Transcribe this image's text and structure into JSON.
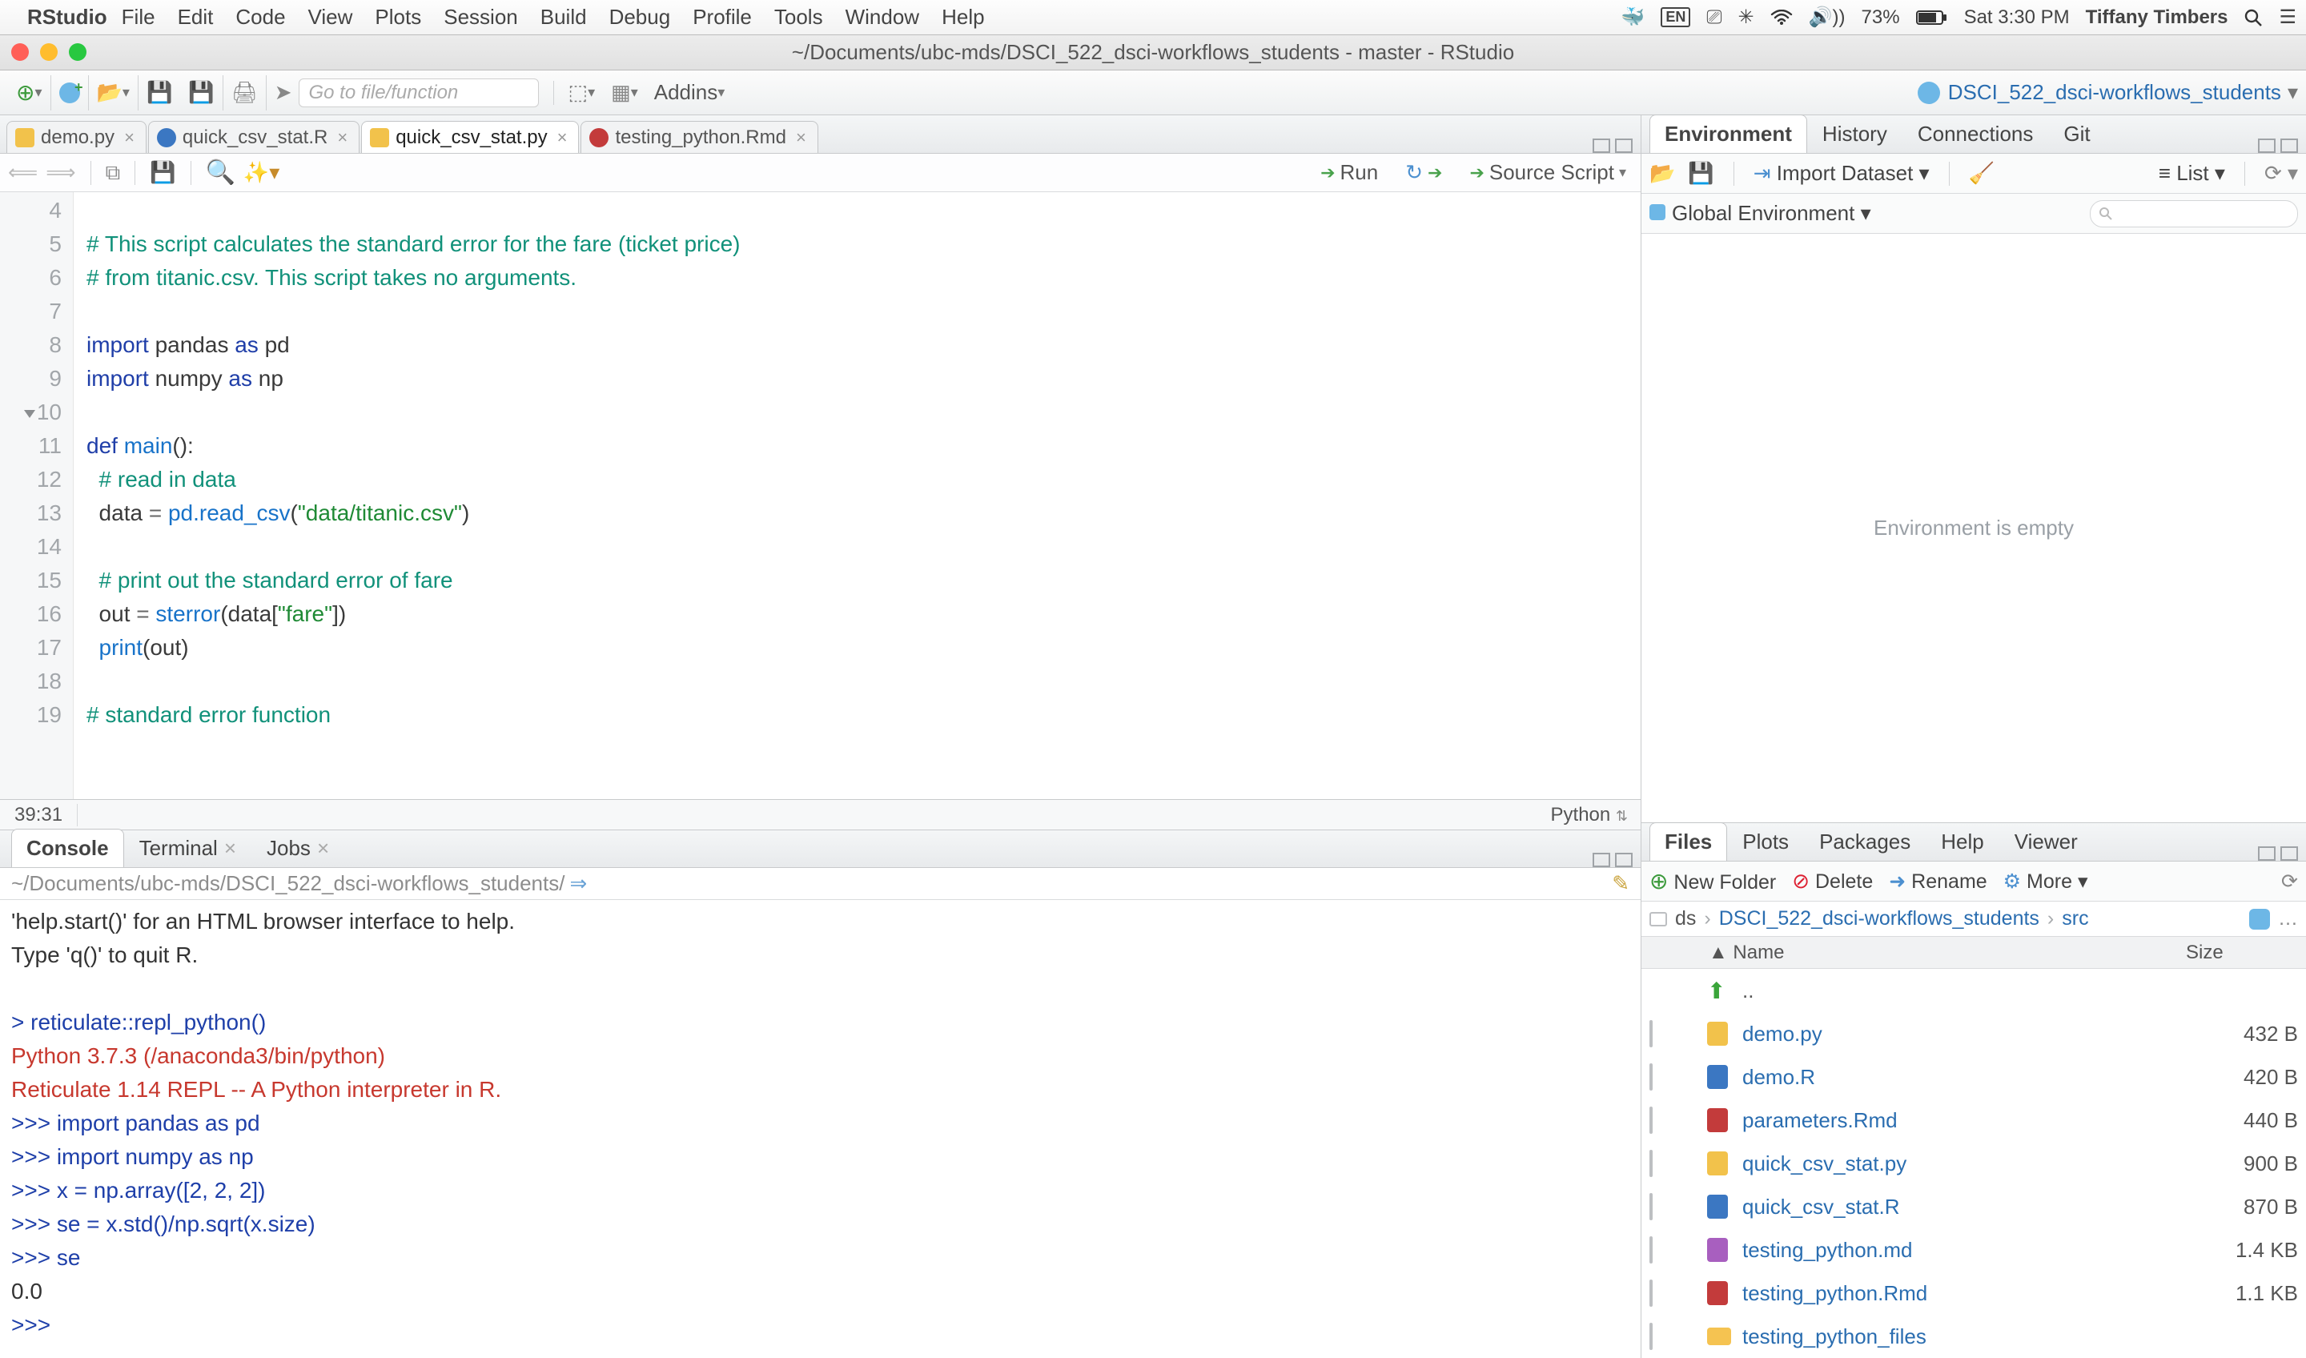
{
  "menubar": {
    "app": "RStudio",
    "items": [
      "File",
      "Edit",
      "Code",
      "View",
      "Plots",
      "Session",
      "Build",
      "Debug",
      "Profile",
      "Tools",
      "Window",
      "Help"
    ],
    "battery": "73%",
    "clock": "Sat 3:30 PM",
    "user": "Tiffany Timbers"
  },
  "window": {
    "title": "~/Documents/ubc-mds/DSCI_522_dsci-workflows_students - master - RStudio"
  },
  "maintoolbar": {
    "goto_placeholder": "Go to file/function",
    "addins": "Addins",
    "project": "DSCI_522_dsci-workflows_students"
  },
  "source": {
    "tabs": [
      {
        "label": "demo.py",
        "icon": "#f2c24b"
      },
      {
        "label": "quick_csv_stat.R",
        "icon": "#3b77c2"
      },
      {
        "label": "quick_csv_stat.py",
        "icon": "#f2c24b",
        "active": true
      },
      {
        "label": "testing_python.Rmd",
        "icon": "#c33b3b"
      }
    ],
    "run": "Run",
    "source_script": "Source Script",
    "gutter": [
      "4",
      "5",
      "6",
      "7",
      "8",
      "9",
      "10",
      "11",
      "12",
      "13",
      "14",
      "15",
      "16",
      "17",
      "18",
      "19"
    ],
    "status_pos": "39:31",
    "status_lang": "Python"
  },
  "codelines": {
    "l4": "# This script calculates the standard error for the fare (ticket price)",
    "l5": "# from titanic.csv. This script takes no arguments.",
    "l7a": "import",
    "l7b": " pandas ",
    "l7c": "as",
    "l7d": " pd",
    "l8a": "import",
    "l8b": " numpy ",
    "l8c": "as",
    "l8d": " np",
    "l10a": "def",
    "l10b": " main",
    "l10c": "():",
    "l11": "  # read in data",
    "l12a": "  data ",
    "l12b": "=",
    "l12c": " pd.read_csv",
    "l12d": "(",
    "l12e": "\"data/titanic.csv\"",
    "l12f": ")",
    "l14": "  # print out the standard error of fare",
    "l15a": "  out ",
    "l15b": "=",
    "l15c": " sterror",
    "l15d": "(",
    "l15e": "data",
    "l15f": "[",
    "l15g": "\"fare\"",
    "l15h": "])",
    "l16a": "  print",
    "l16b": "(",
    "l16c": "out",
    "l16d": ")",
    "l18": "# standard error function"
  },
  "consolepane": {
    "tabs": [
      "Console",
      "Terminal",
      "Jobs"
    ],
    "path": "~/Documents/ubc-mds/DSCI_522_dsci-workflows_students/",
    "lines": [
      {
        "t": "'help.start()' for an HTML browser interface to help.",
        "cls": ""
      },
      {
        "t": "Type 'q()' to quit R.",
        "cls": ""
      },
      {
        "t": "",
        "cls": ""
      },
      {
        "t": "> reticulate::repl_python()",
        "cls": "pr"
      },
      {
        "t": "Python 3.7.3 (/anaconda3/bin/python)",
        "cls": "red"
      },
      {
        "t": "Reticulate 1.14 REPL -- A Python interpreter in R.",
        "cls": "red"
      },
      {
        "t": ">>> import pandas as pd",
        "cls": "pr"
      },
      {
        "t": ">>> import numpy as np",
        "cls": "pr"
      },
      {
        "t": ">>> x = np.array([2, 2, 2])",
        "cls": "pr"
      },
      {
        "t": ">>> se = x.std()/np.sqrt(x.size)",
        "cls": "pr"
      },
      {
        "t": ">>> se",
        "cls": "pr"
      },
      {
        "t": "0.0",
        "cls": ""
      },
      {
        "t": ">>>",
        "cls": "pr"
      }
    ]
  },
  "env": {
    "tabs": [
      "Environment",
      "History",
      "Connections",
      "Git"
    ],
    "import": "Import Dataset",
    "list": "List",
    "scope": "Global Environment",
    "empty": "Environment is empty"
  },
  "filespane": {
    "tabs": [
      "Files",
      "Plots",
      "Packages",
      "Help",
      "Viewer"
    ],
    "newfolder": "New Folder",
    "delete": "Delete",
    "rename": "Rename",
    "more": "More",
    "crumbs": [
      "ds",
      "DSCI_522_dsci-workflows_students",
      "src"
    ],
    "hdr_name": "Name",
    "hdr_size": "Size",
    "up_label": "..",
    "files": [
      {
        "name": "demo.py",
        "size": "432 B",
        "color": "#f2c24b"
      },
      {
        "name": "demo.R",
        "size": "420 B",
        "color": "#3b77c2"
      },
      {
        "name": "parameters.Rmd",
        "size": "440 B",
        "color": "#c33b3b"
      },
      {
        "name": "quick_csv_stat.py",
        "size": "900 B",
        "color": "#f2c24b"
      },
      {
        "name": "quick_csv_stat.R",
        "size": "870 B",
        "color": "#3b77c2"
      },
      {
        "name": "testing_python.md",
        "size": "1.4 KB",
        "color": "#a85fbf"
      },
      {
        "name": "testing_python.Rmd",
        "size": "1.1 KB",
        "color": "#c33b3b"
      },
      {
        "name": "testing_python_files",
        "size": "",
        "color": "#f5c351",
        "folder": true
      }
    ]
  }
}
